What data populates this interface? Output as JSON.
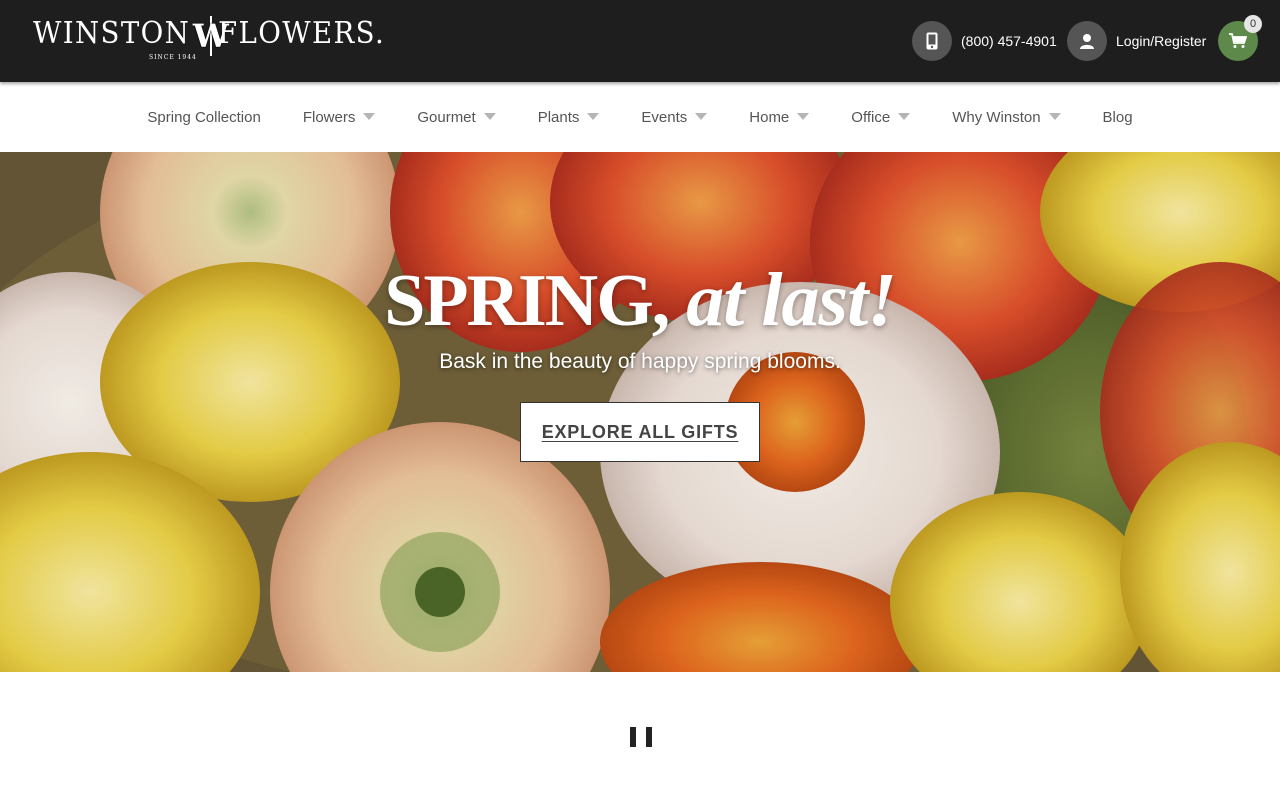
{
  "brand": {
    "name_left": "WINSTON",
    "monogram": "W",
    "name_right": "FLOWERS.",
    "since": "SINCE 1944"
  },
  "header": {
    "phone": "(800) 457-4901",
    "login": "Login/Register",
    "cart_count": "0",
    "icons": {
      "phone": "phone-icon",
      "user": "user-icon",
      "cart": "cart-icon"
    },
    "colors": {
      "bar": "#1e1e1e",
      "circle": "#555555",
      "cart": "#5d8a4b"
    }
  },
  "nav": {
    "items": [
      {
        "label": "Spring Collection",
        "dropdown": false
      },
      {
        "label": "Flowers",
        "dropdown": true
      },
      {
        "label": "Gourmet",
        "dropdown": true
      },
      {
        "label": "Plants",
        "dropdown": true
      },
      {
        "label": "Events",
        "dropdown": true
      },
      {
        "label": "Home",
        "dropdown": true
      },
      {
        "label": "Office",
        "dropdown": true
      },
      {
        "label": "Why Winston",
        "dropdown": true
      },
      {
        "label": "Blog",
        "dropdown": false
      }
    ]
  },
  "hero": {
    "title_caps": "SPRING,",
    "title_script": " at last!",
    "subtitle": "Bask in the beauty of happy spring blooms.",
    "cta": "EXPLORE ALL GIFTS"
  },
  "carousel": {
    "control": "pause-icon"
  }
}
